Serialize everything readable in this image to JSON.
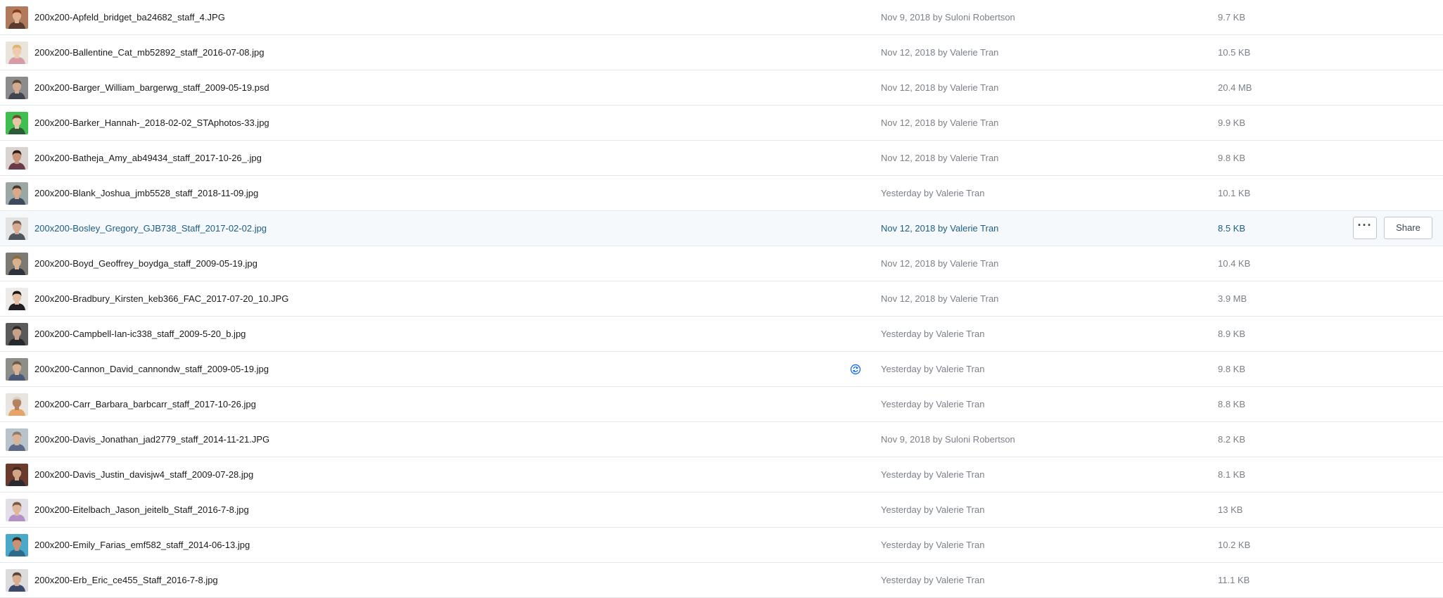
{
  "files": [
    {
      "name": "200x200-Apfeld_bridget_ba24682_staff_4.JPG",
      "modified": "Nov 9, 2018 by Suloni Robertson",
      "size": "9.7 KB",
      "thumb": {
        "bg": "#b07a5c",
        "skin": "#e2b194",
        "hair": "#8a3a1e",
        "shirt": "#5a3b2e"
      }
    },
    {
      "name": "200x200-Ballentine_Cat_mb52892_staff_2016-07-08.jpg",
      "modified": "Nov 12, 2018 by Valerie Tran",
      "size": "10.5 KB",
      "thumb": {
        "bg": "#e9e4dc",
        "skin": "#f0c9ae",
        "hair": "#e0b46e",
        "shirt": "#d79ba8"
      }
    },
    {
      "name": "200x200-Barger_William_bargerwg_staff_2009-05-19.psd",
      "modified": "Nov 12, 2018 by Valerie Tran",
      "size": "20.4 MB",
      "thumb": {
        "bg": "#8c8c8c",
        "skin": "#d3ab90",
        "hair": "#5a4638",
        "shirt": "#3e4652"
      }
    },
    {
      "name": "200x200-Barker_Hannah-_2018-02-02_STAphotos-33.jpg",
      "modified": "Nov 12, 2018 by Valerie Tran",
      "size": "9.9 KB",
      "thumb": {
        "bg": "#3fbf4e",
        "skin": "#e8c3a6",
        "hair": "#6b4a2c",
        "shirt": "#2a5a3a"
      }
    },
    {
      "name": "200x200-Batheja_Amy_ab49434_staff_2017-10-26_.jpg",
      "modified": "Nov 12, 2018 by Valerie Tran",
      "size": "9.8 KB",
      "thumb": {
        "bg": "#d9d4cf",
        "skin": "#c99479",
        "hair": "#2e1d14",
        "shirt": "#6a3b4a"
      }
    },
    {
      "name": "200x200-Blank_Joshua_jmb5528_staff_2018-11-09.jpg",
      "modified": "Yesterday by Valerie Tran",
      "size": "10.1 KB",
      "thumb": {
        "bg": "#9aa7a4",
        "skin": "#d9a98b",
        "hair": "#4a3424",
        "shirt": "#3b4a5c"
      }
    },
    {
      "name": "200x200-Bosley_Gregory_GJB738_Staff_2017-02-02.jpg",
      "modified": "Nov 12, 2018 by Valerie Tran",
      "size": "8.5 KB",
      "thumb": {
        "bg": "#e3e3e3",
        "skin": "#d6ab92",
        "hair": "#6d5a4c",
        "shirt": "#4d5560"
      }
    },
    {
      "name": "200x200-Boyd_Geoffrey_boydga_staff_2009-05-19.jpg",
      "modified": "Nov 12, 2018 by Valerie Tran",
      "size": "10.4 KB",
      "thumb": {
        "bg": "#7d7a72",
        "skin": "#d8b08e",
        "hair": "#8a6a3e",
        "shirt": "#2d3440"
      }
    },
    {
      "name": "200x200-Bradbury_Kirsten_keb366_FAC_2017-07-20_10.JPG",
      "modified": "Nov 12, 2018 by Valerie Tran",
      "size": "3.9 MB",
      "thumb": {
        "bg": "#ecebe8",
        "skin": "#e4bda2",
        "hair": "#1e1612",
        "shirt": "#1f1f24"
      }
    },
    {
      "name": "200x200-Campbell-Ian-ic338_staff_2009-5-20_b.jpg",
      "modified": "Yesterday by Valerie Tran",
      "size": "8.9 KB",
      "thumb": {
        "bg": "#5a5a5a",
        "skin": "#c9a089",
        "hair": "#2a2420",
        "shirt": "#26292e"
      }
    },
    {
      "name": "200x200-Cannon_David_cannondw_staff_2009-05-19.jpg",
      "modified": "Yesterday by Valerie Tran",
      "size": "9.8 KB",
      "thumb": {
        "bg": "#8e8e88",
        "skin": "#d8b292",
        "hair": "#6a5644",
        "shirt": "#4a5a78"
      }
    },
    {
      "name": "200x200-Carr_Barbara_barbcarr_staff_2017-10-26.jpg",
      "modified": "Yesterday by Valerie Tran",
      "size": "8.8 KB",
      "thumb": {
        "bg": "#e8e5e0",
        "skin": "#b5835f",
        "hair": "#d9d3c8",
        "shirt": "#e8a366"
      }
    },
    {
      "name": "200x200-Davis_Jonathan_jad2779_staff_2014-11-21.JPG",
      "modified": "Nov 9, 2018 by Suloni Robertson",
      "size": "8.2 KB",
      "thumb": {
        "bg": "#b9c3cc",
        "skin": "#ddb397",
        "hair": "#8c7a6a",
        "shirt": "#5a6a88"
      }
    },
    {
      "name": "200x200-Davis_Justin_davisjw4_staff_2009-07-28.jpg",
      "modified": "Yesterday by Valerie Tran",
      "size": "8.1 KB",
      "thumb": {
        "bg": "#6a3a2c",
        "skin": "#d1a586",
        "hair": "#3d2a1e",
        "shirt": "#2a2a30"
      }
    },
    {
      "name": "200x200-Eitelbach_Jason_jeitelb_Staff_2016-7-8.jpg",
      "modified": "Yesterday by Valerie Tran",
      "size": "13 KB",
      "thumb": {
        "bg": "#e2dfe7",
        "skin": "#e0b79c",
        "hair": "#7a5a40",
        "shirt": "#b48fc8"
      }
    },
    {
      "name": "200x200-Emily_Farias_emf582_staff_2014-06-13.jpg",
      "modified": "Yesterday by Valerie Tran",
      "size": "10.2 KB",
      "thumb": {
        "bg": "#4aa8c8",
        "skin": "#c99274",
        "hair": "#3a2418",
        "shirt": "#2e6a8c"
      }
    },
    {
      "name": "200x200-Erb_Eric_ce455_Staff_2016-7-8.jpg",
      "modified": "Yesterday by Valerie Tran",
      "size": "11.1 KB",
      "thumb": {
        "bg": "#dcdcdc",
        "skin": "#d9ad90",
        "hair": "#5a4434",
        "shirt": "#3a4a6a"
      }
    }
  ],
  "hover_row_index": 6,
  "sync_row_index": 10,
  "actions": {
    "more_label": "···",
    "share_label": "Share"
  },
  "colors": {
    "accent": "#1c5e84",
    "hover_bg": "#f5f9fc",
    "muted_text": "#7b8088",
    "sync_icon": "#0061fe"
  }
}
